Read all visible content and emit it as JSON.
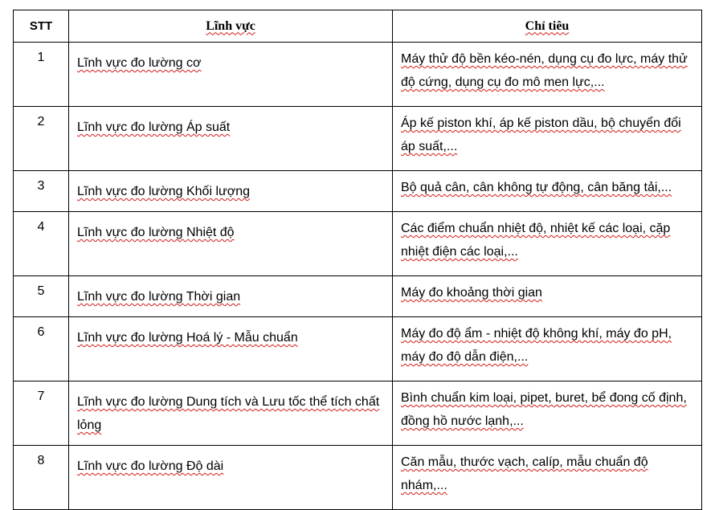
{
  "table": {
    "headers": {
      "stt": "STT",
      "field": "Lĩnh vực",
      "target": "Chỉ tiêu"
    },
    "rows": [
      {
        "stt": "1",
        "field": "Lĩnh vực đo lường cơ",
        "target": "Máy thử độ bền kéo-nén, dụng cụ đo lực, máy thử độ cứng, dụng cụ đo mô men lực,..."
      },
      {
        "stt": "2",
        "field": "Lĩnh vực đo lường Áp suất",
        "target": "Áp kế piston khí, áp kế piston dầu, bộ chuyển đổi áp suất,..."
      },
      {
        "stt": "3",
        "field": "Lĩnh vực đo lường Khối lượng",
        "target": "Bộ quả cân, cân không tự động, cân băng tải,..."
      },
      {
        "stt": "4",
        "field": "Lĩnh vực đo lường Nhiệt độ",
        "target": "Các điểm chuẩn nhiệt độ, nhiệt kế các loại, cặp nhiệt điện các loại,..."
      },
      {
        "stt": "5",
        "field": "Lĩnh vực đo lường Thời gian",
        "target": "Máy đo khoảng thời gian"
      },
      {
        "stt": "6",
        "field": "Lĩnh vực đo lường Hoá lý - Mẫu chuẩn",
        "target": "Máy đo độ ẩm - nhiệt độ không khí, máy đo pH, máy đo độ dẫn điện,..."
      },
      {
        "stt": "7",
        "field": "Lĩnh vực đo lường Dung tích và Lưu tốc thể tích chất lỏng",
        "target": "Bình chuẩn kim loại, pipet, buret, bể đong cố định, đồng hồ nước lạnh,..."
      },
      {
        "stt": "8",
        "field": "Lĩnh vực đo lường Độ dài",
        "target": "Căn mẫu, thước vạch, calíp, mẫu chuẩn độ nhám,..."
      }
    ]
  }
}
